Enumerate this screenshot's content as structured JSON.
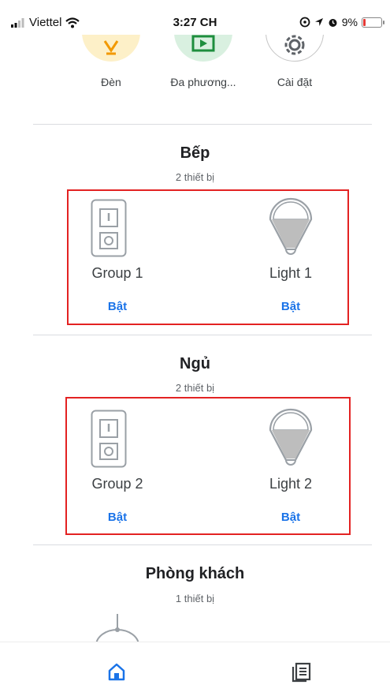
{
  "status_bar": {
    "carrier": "Viettel",
    "time": "3:27 CH",
    "battery": "9%"
  },
  "quick_actions": [
    {
      "label": "Đèn"
    },
    {
      "label": "Đa phương..."
    },
    {
      "label": "Cài đặt"
    }
  ],
  "rooms": [
    {
      "name": "Bếp",
      "device_count": "2 thiết bị",
      "devices": [
        {
          "name": "Group 1",
          "action": "Bật",
          "type": "switch"
        },
        {
          "name": "Light 1",
          "action": "Bật",
          "type": "light"
        }
      ]
    },
    {
      "name": "Ngủ",
      "device_count": "2 thiết bị",
      "devices": [
        {
          "name": "Group 2",
          "action": "Bật",
          "type": "switch"
        },
        {
          "name": "Light 2",
          "action": "Bật",
          "type": "light"
        }
      ]
    },
    {
      "name": "Phòng khách",
      "device_count": "1 thiết bị",
      "devices": []
    }
  ],
  "bottom_nav": [
    {
      "icon": "home-icon",
      "active": true
    },
    {
      "icon": "feed-icon",
      "active": false
    }
  ],
  "colors": {
    "accent": "#1a73e8",
    "highlight_border": "#e32222",
    "divider": "#dadce0"
  }
}
